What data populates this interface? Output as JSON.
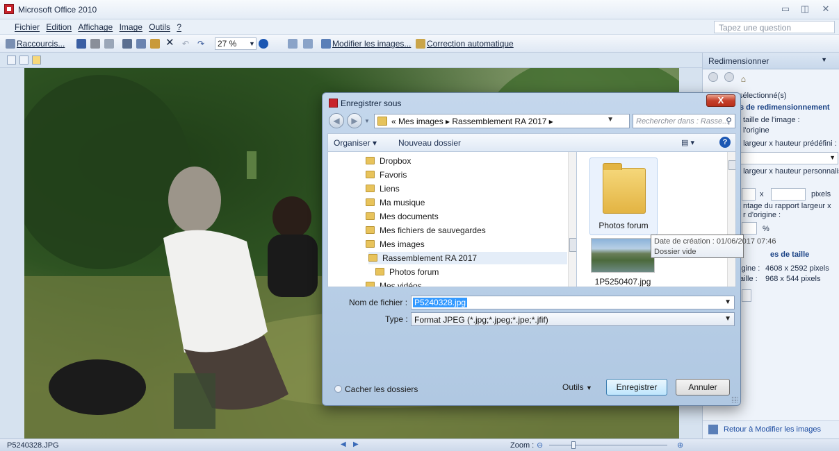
{
  "window": {
    "title": "Microsoft Office 2010"
  },
  "menu": {
    "items": [
      "Fichier",
      "Edition",
      "Affichage",
      "Image",
      "Outils",
      "?"
    ],
    "question_placeholder": "Tapez une question"
  },
  "toolbar": {
    "shortcuts_label": "Raccourcis...",
    "zoom_value": "27 %",
    "edit_images_label": "Modifier les images...",
    "auto_correct_label": "Correction automatique"
  },
  "task_pane": {
    "title": "Redimensionner",
    "selected_text": "sélectionné(s)",
    "section_resize": "s de redimensionnement",
    "image_size_label": "taille de l'image :",
    "origin_label": "l'origine",
    "preset_label": "t largeur x hauteur prédéfini :",
    "custom_label": "t largeur x hauteur personnalisé",
    "x_label": "x",
    "pixels_label": "pixels",
    "ratio_label_1": "ntage du rapport largeur x",
    "ratio_label_2": "r d'origine :",
    "percent_label": "%",
    "size_section": "es de taille",
    "origin_size_label": "igine :",
    "origin_size_value": "4608 x 2592 pixels",
    "new_size_label": "aille :",
    "new_size_value": "968 x 544 pixels",
    "back_link": "Retour à Modifier les images"
  },
  "status_bar": {
    "filename": "P5240328.JPG",
    "zoom_label": "Zoom :"
  },
  "dialog": {
    "title": "Enregistrer sous",
    "close_label": "X",
    "address_path": "« Mes images ▸ Rassemblement RA 2017 ▸",
    "search_placeholder": "Rechercher dans : Rasse...",
    "organize_label": "Organiser ▾",
    "new_folder_label": "Nouveau dossier",
    "tree": [
      "Dropbox",
      "Favoris",
      "Liens",
      "Ma musique",
      "Mes documents",
      "Mes fichiers de sauvegardes",
      "Mes images",
      "Rassemblement RA 2017",
      "Photos forum",
      "Mes vidéos"
    ],
    "files": [
      {
        "name": "Photos forum",
        "kind": "folder"
      },
      {
        "name": "1P5250407.jpg",
        "kind": "image"
      }
    ],
    "tooltip_line1": "Date de création : 01/06/2017 07:46",
    "tooltip_line2": "Dossier vide",
    "filename_label": "Nom de fichier :",
    "filename_value": "P5240328.jpg",
    "type_label": "Type :",
    "type_value": "Format JPEG (*.jpg;*.jpeg;*.jpe;*.jfif)",
    "hide_folders_label": "Cacher les dossiers",
    "tools_label": "Outils",
    "save_label": "Enregistrer",
    "cancel_label": "Annuler"
  }
}
